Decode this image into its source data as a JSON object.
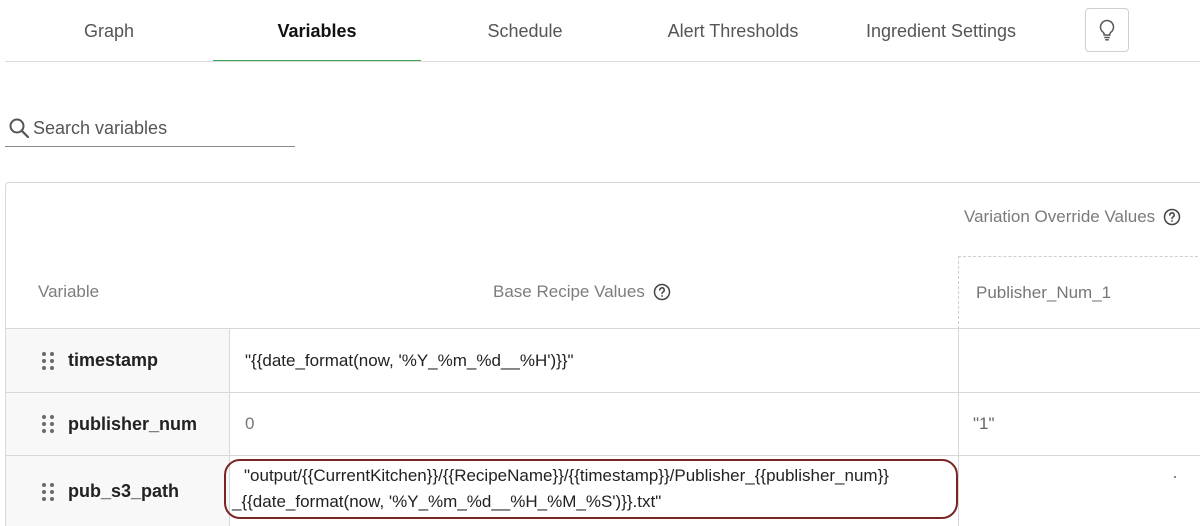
{
  "tabs": {
    "graph": "Graph",
    "variables": "Variables",
    "schedule": "Schedule",
    "alert_thresholds": "Alert Thresholds",
    "ingredient_settings": "Ingredient Settings"
  },
  "search": {
    "placeholder": "Search variables",
    "value": ""
  },
  "table": {
    "variation_override_header": "Variation Override Values",
    "col_variable": "Variable",
    "col_base": "Base Recipe Values",
    "override_column": "Publisher_Num_1",
    "rows": [
      {
        "name": "timestamp",
        "base": "\"{{date_format(now, '%Y_%m_%d__%H')}}\"",
        "override": ""
      },
      {
        "name": "publisher_num",
        "base": "0",
        "override": "\"1\""
      },
      {
        "name": "pub_s3_path",
        "base_line1": "\"output/{{CurrentKitchen}}/{{RecipeName}}/{{timestamp}}/Publisher_{{publisher_num}}",
        "base_line2": "_{{date_format(now, '%Y_%m_%d__%H_%M_%S')}}.txt\"",
        "override": ""
      }
    ]
  },
  "colors": {
    "active_tab_underline": "#3aa757",
    "highlight_border": "#7a2626"
  }
}
